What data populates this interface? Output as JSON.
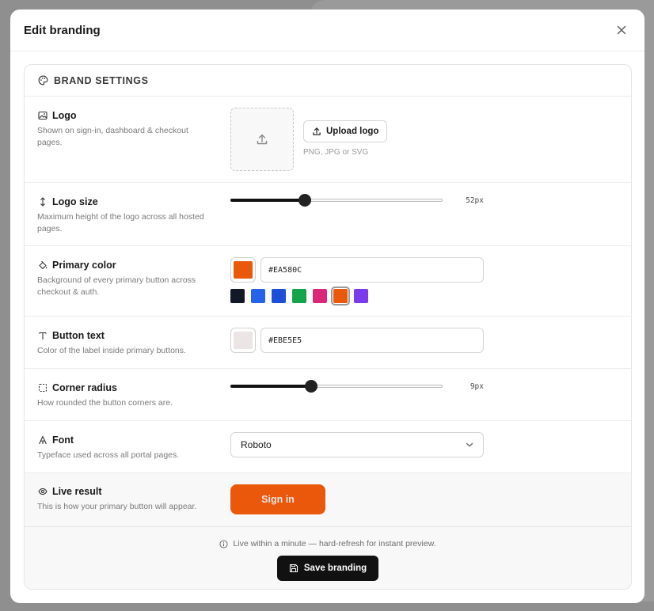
{
  "modal": {
    "title": "Edit branding"
  },
  "section": {
    "heading": "BRAND SETTINGS"
  },
  "logo": {
    "title": "Logo",
    "description": "Shown on sign-in, dashboard & checkout pages.",
    "upload_label": "Upload logo",
    "hint": "PNG, JPG or SVG"
  },
  "logo_size": {
    "title": "Logo size",
    "description": "Maximum height of the logo across all hosted pages.",
    "value_label": "52px",
    "fraction": 0.35
  },
  "primary_color": {
    "title": "Primary color",
    "description": "Background of every primary button across checkout & auth.",
    "value": "#EA580C",
    "presets": [
      "#111827",
      "#2563EB",
      "#1D4ED8",
      "#16A34A",
      "#DB2777",
      "#EA580C",
      "#7C3AED"
    ],
    "selected_preset": 5
  },
  "button_text": {
    "title": "Button text",
    "description": "Color of the label inside primary buttons.",
    "value": "#EBE5E5"
  },
  "corner_radius": {
    "title": "Corner radius",
    "description": "How rounded the button corners are.",
    "value_label": "9px",
    "fraction": 0.38
  },
  "font": {
    "title": "Font",
    "description": "Typeface used across all portal pages.",
    "selected": "Roboto"
  },
  "live_result": {
    "title": "Live result",
    "description": "This is how your primary button will appear.",
    "button_label": "Sign in"
  },
  "footer": {
    "note": "Live within a minute — hard-refresh for instant preview.",
    "save_label": "Save branding"
  }
}
